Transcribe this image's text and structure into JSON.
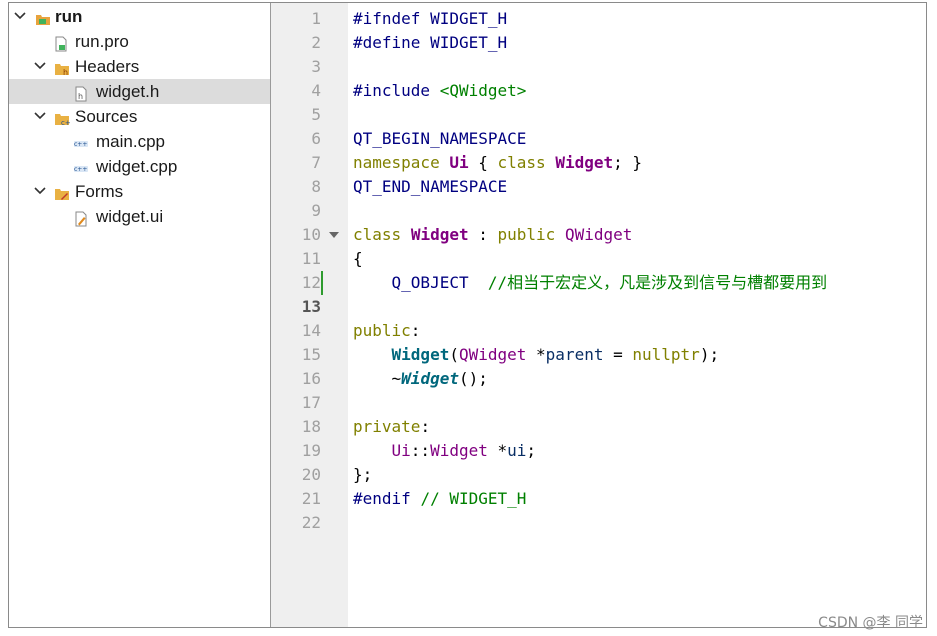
{
  "project_tree": {
    "root": {
      "label": "run",
      "icon": "qt-project-icon"
    },
    "items": [
      {
        "label": "run.pro",
        "icon": "pro-file-icon"
      },
      {
        "label": "Headers",
        "icon": "header-folder-icon"
      },
      {
        "label": "widget.h",
        "icon": "header-file-icon",
        "selected": true
      },
      {
        "label": "Sources",
        "icon": "source-folder-icon"
      },
      {
        "label": "main.cpp",
        "icon": "cpp-file-icon"
      },
      {
        "label": "widget.cpp",
        "icon": "cpp-file-icon"
      },
      {
        "label": "Forms",
        "icon": "forms-folder-icon"
      },
      {
        "label": "widget.ui",
        "icon": "ui-file-icon"
      }
    ]
  },
  "editor": {
    "line_numbers": [
      "1",
      "2",
      "3",
      "4",
      "5",
      "6",
      "7",
      "8",
      "9",
      "10",
      "11",
      "12",
      "13",
      "14",
      "15",
      "16",
      "17",
      "18",
      "19",
      "20",
      "21",
      "22"
    ],
    "current_line": "13",
    "lines": {
      "l1": {
        "a": "#ifndef WIDGET_H"
      },
      "l2": {
        "a": "#define WIDGET_H"
      },
      "l4": {
        "a": "#include ",
        "b": "<QWidget>"
      },
      "l6": {
        "a": "QT_BEGIN_NAMESPACE"
      },
      "l7": {
        "a": "namespace",
        "b": " ",
        "c": "Ui",
        "d": " { ",
        "e": "class",
        "f": " ",
        "g": "Widget",
        "h": "; }"
      },
      "l8": {
        "a": "QT_END_NAMESPACE"
      },
      "l10": {
        "a": "class",
        "b": " ",
        "c": "Widget",
        "d": " : ",
        "e": "public",
        "f": " ",
        "g": "QWidget"
      },
      "l11": {
        "a": "{"
      },
      "l12": {
        "a": "    ",
        "b": "Q_OBJECT",
        "c": "  ",
        "d": "//相当于宏定义，凡是涉及到信号与槽都要用到"
      },
      "l14": {
        "a": "public",
        "b": ":"
      },
      "l15": {
        "a": "    ",
        "b": "Widget",
        "c": "(",
        "d": "QWidget",
        "e": " *",
        "f": "parent",
        "g": " = ",
        "h": "nullptr",
        "i": ");"
      },
      "l16": {
        "a": "    ~",
        "b": "Widget",
        "c": "();"
      },
      "l18": {
        "a": "private",
        "b": ":"
      },
      "l19": {
        "a": "    ",
        "b": "Ui",
        "c": "::",
        "d": "Widget",
        "e": " *",
        "f": "ui",
        "g": ";"
      },
      "l20": {
        "a": "};"
      },
      "l21": {
        "a": "#endif",
        "b": " ",
        "c": "// WIDGET_H"
      }
    }
  },
  "watermark": "CSDN @李 同学",
  "colors": {
    "preprocessor": "#000080",
    "keyword": "#808000",
    "type": "#800080",
    "function": "#00677c",
    "string_comment": "#008000"
  }
}
